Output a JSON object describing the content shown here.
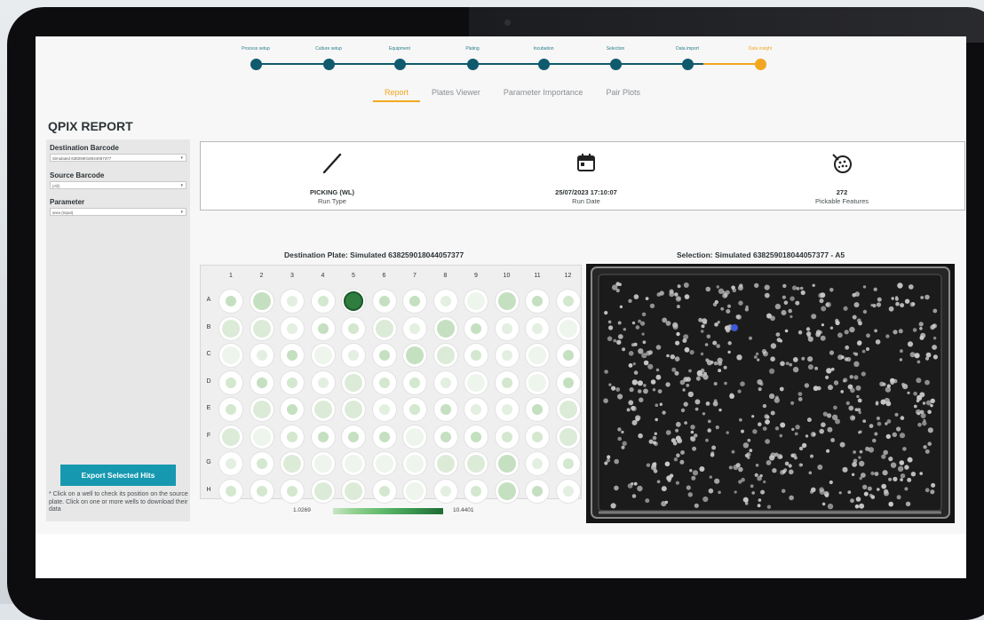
{
  "stepper": {
    "steps": [
      {
        "label": "Process setup"
      },
      {
        "label": "Culture setup"
      },
      {
        "label": "Equipment"
      },
      {
        "label": "Plating"
      },
      {
        "label": "Incubation"
      },
      {
        "label": "Selection"
      },
      {
        "label": "Data import"
      },
      {
        "label": "Data insight"
      }
    ],
    "active_index": 7
  },
  "tabs": [
    {
      "label": "Report",
      "active": true
    },
    {
      "label": "Plates Viewer",
      "active": false
    },
    {
      "label": "Parameter Importance",
      "active": false
    },
    {
      "label": "Pair Plots",
      "active": false
    }
  ],
  "report_title": "QPIX REPORT",
  "sidebar": {
    "destination_label": "Destination Barcode",
    "destination_value": "Simulated 638259018044057377",
    "source_label": "Source Barcode",
    "source_value": "(All)",
    "parameter_label": "Parameter",
    "parameter_value": "area (Input)",
    "export_label": "Export Selected Hits",
    "note": "* Click on a well to check its position on the source plate. Click on one or more wells to download their data"
  },
  "summary": {
    "run_type_value": "PICKING (WL)",
    "run_type_label": "Run Type",
    "run_date_value": "25/07/2023 17:10:07",
    "run_date_label": "Run Date",
    "features_value": "272",
    "features_label": "Pickable Features"
  },
  "destination_plate": {
    "title": "Destination Plate: Simulated 638259018044057377",
    "columns": [
      "1",
      "2",
      "3",
      "4",
      "5",
      "6",
      "7",
      "8",
      "9",
      "10",
      "11",
      "12"
    ],
    "rows": [
      "A",
      "B",
      "C",
      "D",
      "E",
      "F",
      "G",
      "H"
    ],
    "selected_well": "A5",
    "legend_min": "1.0269",
    "legend_max": "10.4401"
  },
  "selection": {
    "title": "Selection: Simulated 638259018044057377 - A5"
  },
  "colors": {
    "accent": "#f2a720",
    "teal": "#0f5a6c",
    "button": "#1699b0",
    "selected_well": "#2f7d3f"
  }
}
